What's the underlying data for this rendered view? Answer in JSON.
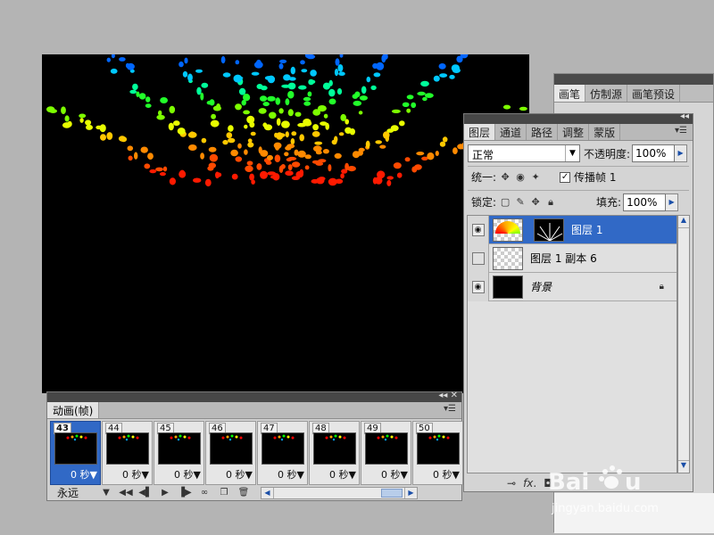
{
  "brush_panel": {
    "tabs": [
      "画笔",
      "仿制源",
      "画笔预设"
    ]
  },
  "layers_panel": {
    "tabs": [
      "图层",
      "通道",
      "路径",
      "调整",
      "蒙版"
    ],
    "blend_mode": "正常",
    "opacity_label": "不透明度:",
    "opacity_value": "100%",
    "unify_label": "统一:",
    "propagate_label": "传播帧 1",
    "lock_label": "锁定:",
    "fill_label": "填充:",
    "fill_value": "100%",
    "layers": [
      {
        "name": "图层 1",
        "visible": true,
        "selected": true
      },
      {
        "name": "图层 1 副本 6",
        "visible": false,
        "selected": false
      },
      {
        "name": "背景",
        "visible": true,
        "selected": false,
        "locked": true
      }
    ],
    "bottom_icons": [
      "link-icon",
      "fx-icon"
    ]
  },
  "animation_panel": {
    "tab": "动画(帧)",
    "loop": "永远",
    "frames": [
      {
        "number": "43",
        "duration": "0 秒▼",
        "selected": true
      },
      {
        "number": "44",
        "duration": "0 秒▼"
      },
      {
        "number": "45",
        "duration": "0 秒▼"
      },
      {
        "number": "46",
        "duration": "0 秒▼"
      },
      {
        "number": "47",
        "duration": "0 秒▼"
      },
      {
        "number": "48",
        "duration": "0 秒▼"
      },
      {
        "number": "49",
        "duration": "0 秒▼"
      },
      {
        "number": "50",
        "duration": "0 秒▼"
      }
    ]
  },
  "watermark": {
    "url": "jingyan.baidu.com"
  },
  "colors": {
    "selection": "#3169c6",
    "panel_bg": "#d4d4d4",
    "canvas_bg": "#000000"
  }
}
